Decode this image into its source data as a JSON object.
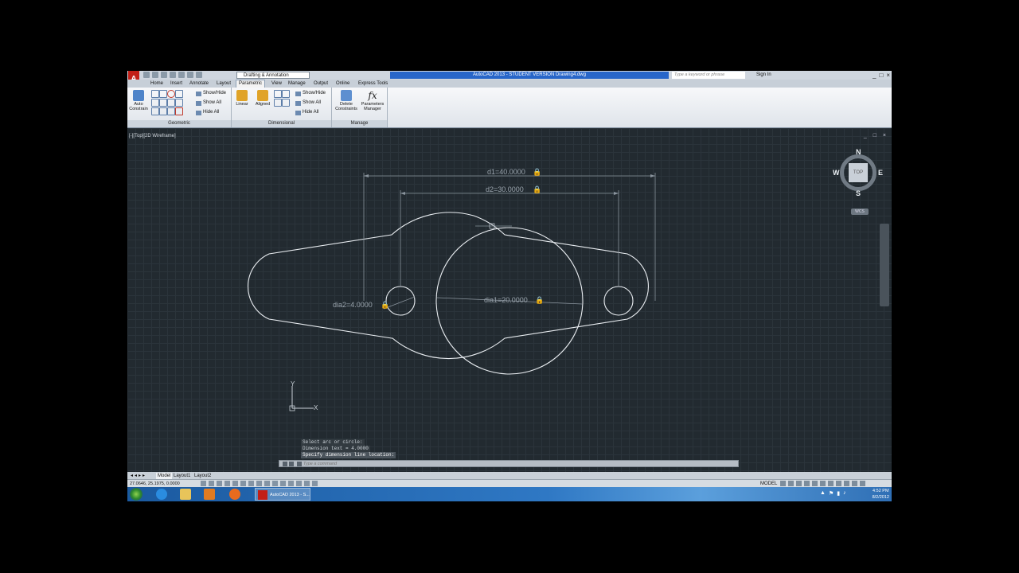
{
  "window": {
    "app_button": "A",
    "workspace": "Drafting & Annotation",
    "title": "AutoCAD 2013 - STUDENT VERSION   Drawing4.dwg",
    "search_placeholder": "Type a keyword or phrase",
    "sign_in": "Sign In",
    "controls": [
      "_",
      "□",
      "×"
    ]
  },
  "tabs": [
    "Home",
    "Insert",
    "Annotate",
    "Layout",
    "Parametric",
    "View",
    "Manage",
    "Output",
    "Online",
    "Express Tools"
  ],
  "active_tab": "Parametric",
  "ribbon": {
    "geometric": {
      "title": "Geometric",
      "auto_constrain": "Auto Constrain",
      "show_hide": "Show/Hide",
      "show_all": "Show All",
      "hide_all": "Hide All"
    },
    "dimensional": {
      "title": "Dimensional",
      "linear": "Linear",
      "aligned": "Aligned",
      "show_hide": "Show/Hide",
      "show_all": "Show All",
      "hide_all": "Hide All"
    },
    "manage": {
      "title": "Manage",
      "delete_constraints": "Delete Constraints",
      "parameters_manager": "Parameters Manager",
      "fx": "fx"
    }
  },
  "viewport": {
    "label": "[-][Top][2D Wireframe]",
    "controls": "_ □ ×"
  },
  "drawing": {
    "dimensions": {
      "d1": "d1=40.0000",
      "d2": "d2=30.0000",
      "dia1": "dia1=20.0000",
      "dia2": "dia2=4.0000"
    },
    "lock_glyph": "🔒"
  },
  "viewcube": {
    "north": "N",
    "south": "S",
    "east": "E",
    "west": "W",
    "face": "TOP",
    "wcs": "WCS"
  },
  "ucs": {
    "x": "X",
    "y": "Y"
  },
  "command": {
    "history": [
      "Select arc or circle:",
      "Dimension text = 4.0000",
      "Specify dimension line location:"
    ],
    "placeholder": "Type a command"
  },
  "layout_tabs": [
    "Model",
    "Layout1",
    "Layout2"
  ],
  "status": {
    "coordinates": "27.0646, 25.1975, 0.0000",
    "model": "MODEL"
  },
  "taskbar": {
    "active_app": "AutoCAD 2013 - S...",
    "time": "4:52 PM",
    "date": "8/2/2012"
  }
}
